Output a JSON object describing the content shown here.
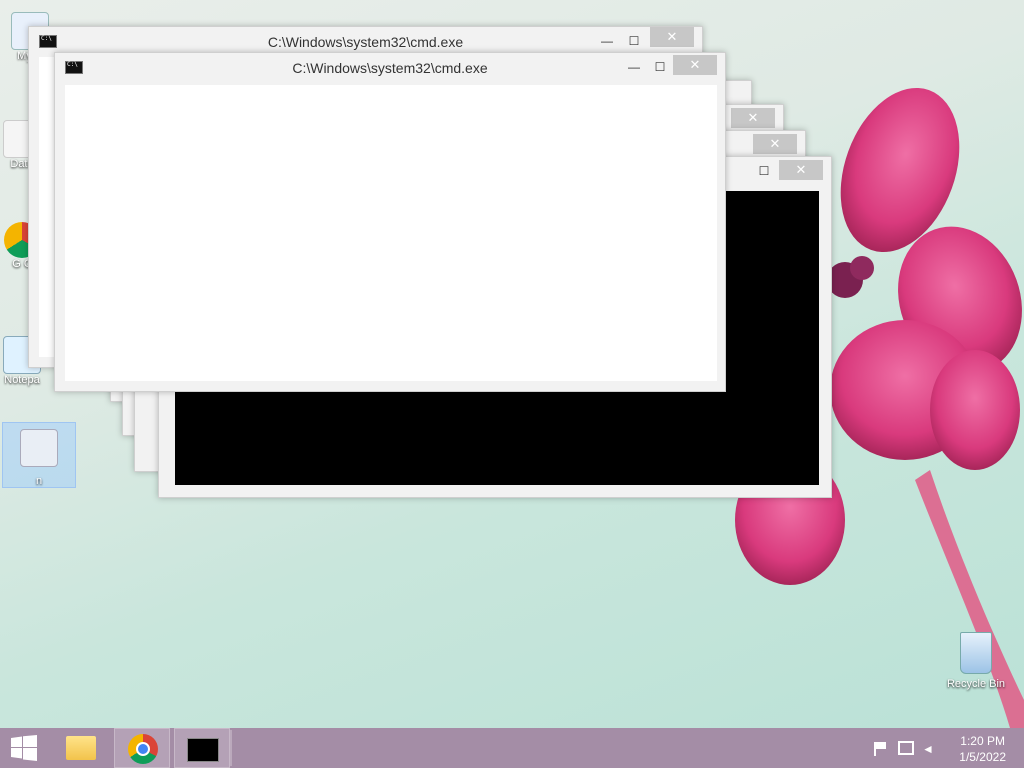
{
  "desktop": {
    "icons": [
      {
        "label": "My C"
      },
      {
        "label": "Data"
      },
      {
        "label": "G\nC"
      },
      {
        "label": "Notepa"
      },
      {
        "label": "n"
      },
      {
        "label": "Recycle Bin"
      }
    ]
  },
  "windows": [
    {
      "title": "C:\\Windows\\system32\\cmd.exe"
    },
    {
      "title": "C:\\Windows\\system32\\cmd.exe"
    }
  ],
  "controls": {
    "minimize": "—",
    "maximize": "☐",
    "close": "✕"
  },
  "taskbar": {
    "time": "1:20 PM",
    "date": "1/5/2022"
  },
  "colors": {
    "taskbar": "#a48da6",
    "close_button": "#c7c7c7",
    "console_bg": "#000000"
  }
}
